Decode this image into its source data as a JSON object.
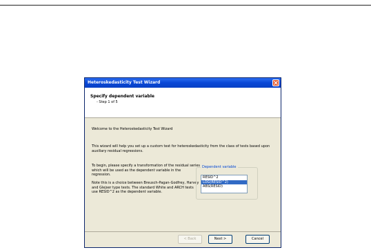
{
  "window": {
    "title": "Heteroskedasticity Test Wizard"
  },
  "header": {
    "title": "Specify dependent variable",
    "step": "- Step 1 of 5"
  },
  "body": {
    "welcome": "Welcome to the Heteroskedasticity Test Wizard",
    "intro": "This wizard will help you set up a custom test for heteroskedasticity from the class of tests based upon auxiliary residual regressions.",
    "para_a": "To begin, please specify a transformation of the residual series which will be used as the dependent variable in the regression.",
    "para_b": "Note this is a choice between Breusch-Pagan-Godfrey, Harvey and Glejser type tests. The standard White and ARCH tests use RESID^2 as the dependent variable."
  },
  "dependent_variable": {
    "label": "Dependent variable",
    "options": [
      "RESID^2",
      "LOG(RESID^2)",
      "ABS(RESID)"
    ],
    "selected": "LOG(RESID^2)"
  },
  "buttons": {
    "back": "< Back",
    "next": "Next >",
    "cancel": "Cancel"
  }
}
